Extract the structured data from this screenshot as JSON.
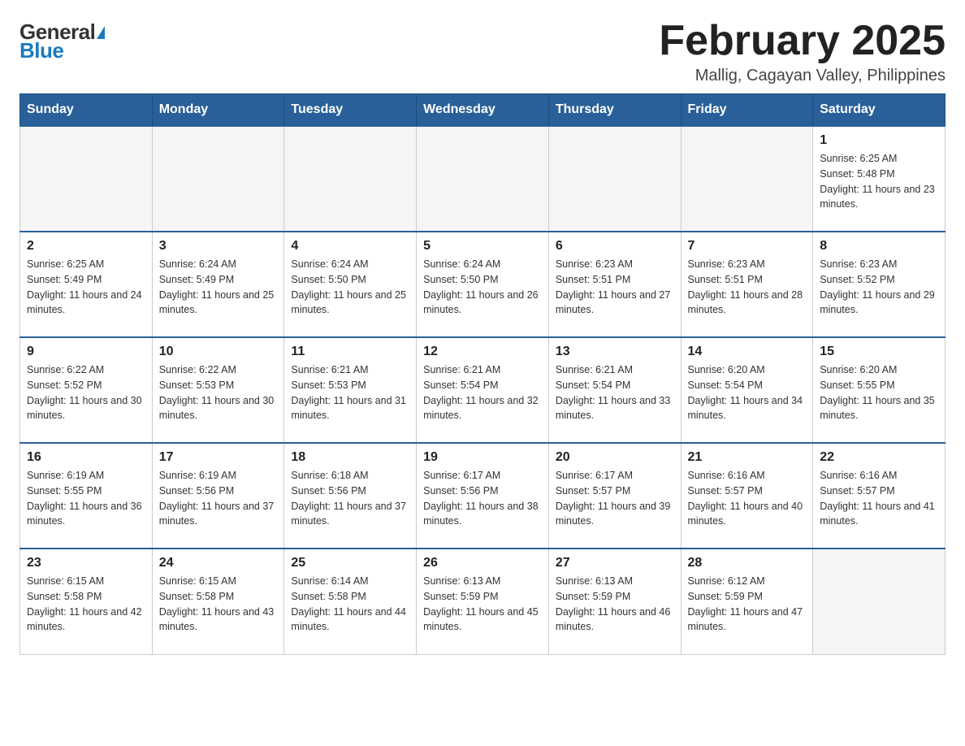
{
  "header": {
    "logo_general": "General",
    "logo_blue": "Blue",
    "month_title": "February 2025",
    "location": "Mallig, Cagayan Valley, Philippines"
  },
  "days_of_week": [
    "Sunday",
    "Monday",
    "Tuesday",
    "Wednesday",
    "Thursday",
    "Friday",
    "Saturday"
  ],
  "weeks": [
    [
      {
        "day": "",
        "info": ""
      },
      {
        "day": "",
        "info": ""
      },
      {
        "day": "",
        "info": ""
      },
      {
        "day": "",
        "info": ""
      },
      {
        "day": "",
        "info": ""
      },
      {
        "day": "",
        "info": ""
      },
      {
        "day": "1",
        "info": "Sunrise: 6:25 AM\nSunset: 5:48 PM\nDaylight: 11 hours and 23 minutes."
      }
    ],
    [
      {
        "day": "2",
        "info": "Sunrise: 6:25 AM\nSunset: 5:49 PM\nDaylight: 11 hours and 24 minutes."
      },
      {
        "day": "3",
        "info": "Sunrise: 6:24 AM\nSunset: 5:49 PM\nDaylight: 11 hours and 25 minutes."
      },
      {
        "day": "4",
        "info": "Sunrise: 6:24 AM\nSunset: 5:50 PM\nDaylight: 11 hours and 25 minutes."
      },
      {
        "day": "5",
        "info": "Sunrise: 6:24 AM\nSunset: 5:50 PM\nDaylight: 11 hours and 26 minutes."
      },
      {
        "day": "6",
        "info": "Sunrise: 6:23 AM\nSunset: 5:51 PM\nDaylight: 11 hours and 27 minutes."
      },
      {
        "day": "7",
        "info": "Sunrise: 6:23 AM\nSunset: 5:51 PM\nDaylight: 11 hours and 28 minutes."
      },
      {
        "day": "8",
        "info": "Sunrise: 6:23 AM\nSunset: 5:52 PM\nDaylight: 11 hours and 29 minutes."
      }
    ],
    [
      {
        "day": "9",
        "info": "Sunrise: 6:22 AM\nSunset: 5:52 PM\nDaylight: 11 hours and 30 minutes."
      },
      {
        "day": "10",
        "info": "Sunrise: 6:22 AM\nSunset: 5:53 PM\nDaylight: 11 hours and 30 minutes."
      },
      {
        "day": "11",
        "info": "Sunrise: 6:21 AM\nSunset: 5:53 PM\nDaylight: 11 hours and 31 minutes."
      },
      {
        "day": "12",
        "info": "Sunrise: 6:21 AM\nSunset: 5:54 PM\nDaylight: 11 hours and 32 minutes."
      },
      {
        "day": "13",
        "info": "Sunrise: 6:21 AM\nSunset: 5:54 PM\nDaylight: 11 hours and 33 minutes."
      },
      {
        "day": "14",
        "info": "Sunrise: 6:20 AM\nSunset: 5:54 PM\nDaylight: 11 hours and 34 minutes."
      },
      {
        "day": "15",
        "info": "Sunrise: 6:20 AM\nSunset: 5:55 PM\nDaylight: 11 hours and 35 minutes."
      }
    ],
    [
      {
        "day": "16",
        "info": "Sunrise: 6:19 AM\nSunset: 5:55 PM\nDaylight: 11 hours and 36 minutes."
      },
      {
        "day": "17",
        "info": "Sunrise: 6:19 AM\nSunset: 5:56 PM\nDaylight: 11 hours and 37 minutes."
      },
      {
        "day": "18",
        "info": "Sunrise: 6:18 AM\nSunset: 5:56 PM\nDaylight: 11 hours and 37 minutes."
      },
      {
        "day": "19",
        "info": "Sunrise: 6:17 AM\nSunset: 5:56 PM\nDaylight: 11 hours and 38 minutes."
      },
      {
        "day": "20",
        "info": "Sunrise: 6:17 AM\nSunset: 5:57 PM\nDaylight: 11 hours and 39 minutes."
      },
      {
        "day": "21",
        "info": "Sunrise: 6:16 AM\nSunset: 5:57 PM\nDaylight: 11 hours and 40 minutes."
      },
      {
        "day": "22",
        "info": "Sunrise: 6:16 AM\nSunset: 5:57 PM\nDaylight: 11 hours and 41 minutes."
      }
    ],
    [
      {
        "day": "23",
        "info": "Sunrise: 6:15 AM\nSunset: 5:58 PM\nDaylight: 11 hours and 42 minutes."
      },
      {
        "day": "24",
        "info": "Sunrise: 6:15 AM\nSunset: 5:58 PM\nDaylight: 11 hours and 43 minutes."
      },
      {
        "day": "25",
        "info": "Sunrise: 6:14 AM\nSunset: 5:58 PM\nDaylight: 11 hours and 44 minutes."
      },
      {
        "day": "26",
        "info": "Sunrise: 6:13 AM\nSunset: 5:59 PM\nDaylight: 11 hours and 45 minutes."
      },
      {
        "day": "27",
        "info": "Sunrise: 6:13 AM\nSunset: 5:59 PM\nDaylight: 11 hours and 46 minutes."
      },
      {
        "day": "28",
        "info": "Sunrise: 6:12 AM\nSunset: 5:59 PM\nDaylight: 11 hours and 47 minutes."
      },
      {
        "day": "",
        "info": ""
      }
    ]
  ]
}
